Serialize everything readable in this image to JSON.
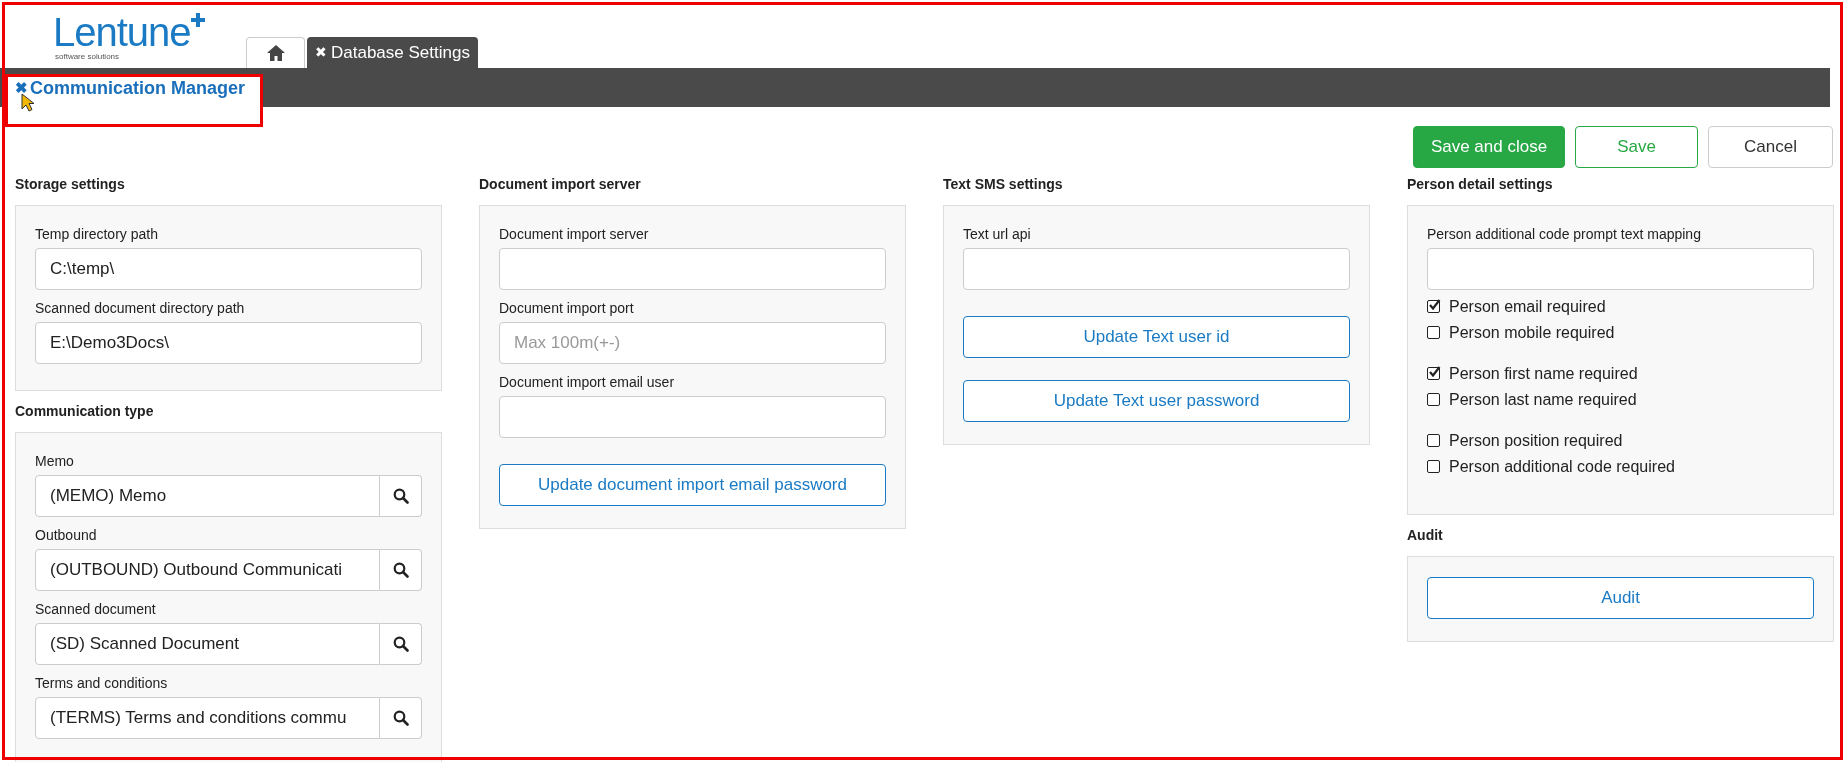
{
  "logo": {
    "name": "Lentune",
    "tagline": "software solutions"
  },
  "tabs": [
    {
      "kind": "home",
      "selected": false
    },
    {
      "kind": "text",
      "label": "Database Settings",
      "close": "✖",
      "selected": true
    }
  ],
  "page_tab": {
    "close": "✖",
    "label": "Communication Manager"
  },
  "actions": [
    {
      "kind": "primary",
      "label": "Save and close"
    },
    {
      "kind": "success_outline",
      "label": "Save"
    },
    {
      "kind": "default",
      "label": "Cancel"
    }
  ],
  "columns": [
    [
      {
        "title": "Storage settings",
        "items": [
          {
            "kind": "text",
            "label": "Temp directory path",
            "value": "C:\\temp\\"
          },
          {
            "kind": "text",
            "label": "Scanned document directory path",
            "value": "E:\\Demo3Docs\\"
          }
        ]
      },
      {
        "title": "Communication type",
        "items": [
          {
            "kind": "lookup",
            "label": "Memo",
            "value": "(MEMO) Memo"
          },
          {
            "kind": "lookup",
            "label": "Outbound",
            "value": "(OUTBOUND) Outbound Communicati"
          },
          {
            "kind": "lookup",
            "label": "Scanned document",
            "value": "(SD) Scanned Document"
          },
          {
            "kind": "lookup",
            "label": "Terms and conditions",
            "value": "(TERMS) Terms and conditions commu"
          }
        ]
      }
    ],
    [
      {
        "title": "Document import server",
        "items": [
          {
            "kind": "text",
            "label": "Document import server"
          },
          {
            "kind": "text",
            "label": "Document import port",
            "placeholder": "Max 100m(+-)"
          },
          {
            "kind": "text",
            "label": "Document import email user"
          },
          {
            "kind": "button",
            "label": "Update document import email password"
          }
        ]
      }
    ],
    [
      {
        "title": "Text SMS settings",
        "items": [
          {
            "kind": "text",
            "label": "Text url api"
          },
          {
            "kind": "button",
            "label": "Update Text user id"
          },
          {
            "kind": "button",
            "label": "Update Text user password"
          }
        ]
      }
    ],
    [
      {
        "title": "Person detail settings",
        "items": [
          {
            "kind": "text",
            "label": "Person additional code prompt text mapping"
          },
          {
            "kind": "checkbox_group",
            "items": [
              {
                "label": "Person email required",
                "checked": true
              },
              {
                "label": "Person mobile required",
                "checked": false
              }
            ]
          },
          {
            "kind": "checkbox_group",
            "items": [
              {
                "label": "Person first name required",
                "checked": true
              },
              {
                "label": "Person last name required",
                "checked": false
              }
            ]
          },
          {
            "kind": "checkbox_group",
            "items": [
              {
                "label": "Person position required",
                "checked": false
              },
              {
                "label": "Person additional code required",
                "checked": false
              }
            ]
          }
        ]
      },
      {
        "title": "Audit",
        "items": [
          {
            "kind": "button",
            "label": "Audit"
          }
        ]
      }
    ]
  ]
}
